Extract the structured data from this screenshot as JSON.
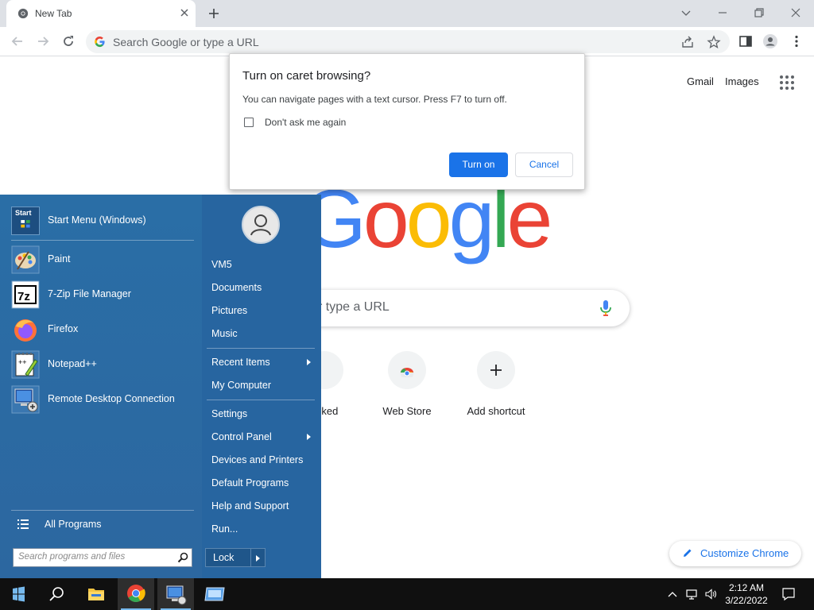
{
  "browser": {
    "tab": {
      "title": "New Tab"
    },
    "omnibox": {
      "placeholder": "Search Google or type a URL"
    }
  },
  "ntp": {
    "links": {
      "gmail": "Gmail",
      "images": "Images"
    },
    "logo": "Google",
    "search_placeholder": "r type a URL",
    "shortcuts": [
      {
        "label": "ocked",
        "icon": "tool-icon"
      },
      {
        "label": "Web Store",
        "icon": "chrome-web-store-icon"
      },
      {
        "label": "Add shortcut",
        "icon": "plus-icon"
      }
    ],
    "customize": "Customize Chrome"
  },
  "dialog": {
    "title": "Turn on caret browsing?",
    "body": "You can navigate pages with a text cursor. Press F7 to turn off.",
    "checkbox_label": "Don't ask me again",
    "checkbox_checked": false,
    "primary": "Turn on",
    "secondary": "Cancel"
  },
  "start_menu": {
    "pinned": [
      {
        "label": "Start Menu (Windows)",
        "icon": "start-menu-app-icon"
      },
      {
        "label": "Paint",
        "icon": "paint-icon"
      },
      {
        "label": "7-Zip File Manager",
        "icon": "7zip-icon"
      },
      {
        "label": "Firefox",
        "icon": "firefox-icon"
      },
      {
        "label": "Notepad++",
        "icon": "notepad-plus-plus-icon"
      },
      {
        "label": "Remote Desktop Connection",
        "icon": "remote-desktop-icon"
      }
    ],
    "start_icon_text": "Start",
    "all_programs": "All Programs",
    "search_placeholder": "Search programs and files",
    "right": {
      "user": "VM5",
      "documents": "Documents",
      "pictures": "Pictures",
      "music": "Music",
      "recent_items": "Recent Items",
      "my_computer": "My Computer",
      "settings": "Settings",
      "control_panel": "Control Panel",
      "devices_printers": "Devices and Printers",
      "default_programs": "Default Programs",
      "help_support": "Help and Support",
      "run": "Run..."
    },
    "lock": "Lock"
  },
  "taskbar": {
    "time": "2:12 AM",
    "date": "3/22/2022"
  },
  "colors": {
    "accent": "#1a73e8",
    "start_menu_bg": "#2a6ea6",
    "taskbar_bg": "#101010"
  }
}
